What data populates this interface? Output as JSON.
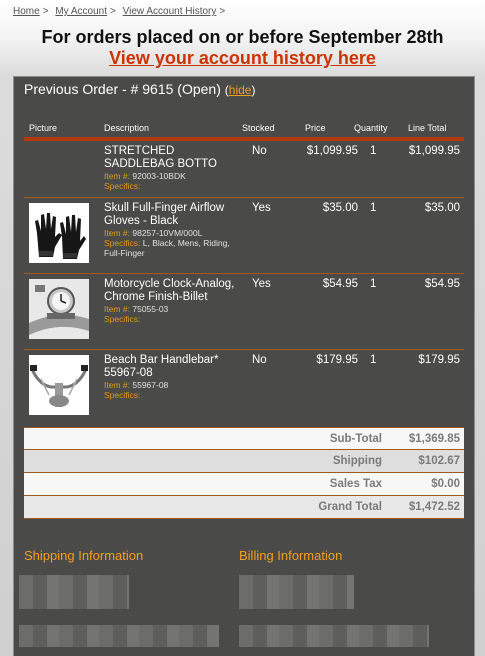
{
  "breadcrumb": {
    "items": [
      "Home",
      "My Account",
      "View Account History"
    ],
    "separator": ">"
  },
  "headline": "For orders placed on or before September 28th",
  "history_link": "View your account history here",
  "order": {
    "title": "Previous Order - # 9615 (Open)",
    "hide_open": "(",
    "hide_label": "hide",
    "hide_close": ")"
  },
  "table": {
    "headers": {
      "picture": "Picture",
      "description": "Description",
      "stocked": "Stocked",
      "price": "Price",
      "quantity": "Quantity",
      "line_total": "Line Total"
    },
    "item_label": "Item #:",
    "specifics_label": "Specifics:",
    "rows": [
      {
        "name": "STRETCHED SADDLEBAG BOTTO",
        "item_no": "92003-10BDK",
        "specifics": "",
        "stocked": "No",
        "price": "$1,099.95",
        "qty": "1",
        "total": "$1,099.95"
      },
      {
        "name": "Skull Full-Finger Airflow Gloves - Black",
        "item_no": "98257-10VM/000L",
        "specifics": "L, Black, Mens, Riding, Full-Finger",
        "stocked": "Yes",
        "price": "$35.00",
        "qty": "1",
        "total": "$35.00"
      },
      {
        "name": "Motorcycle Clock-Analog, Chrome Finish-Billet",
        "item_no": "75055-03",
        "specifics": "",
        "stocked": "Yes",
        "price": "$54.95",
        "qty": "1",
        "total": "$54.95"
      },
      {
        "name": "Beach Bar Handlebar* 55967-08",
        "item_no": "55967-08",
        "specifics": "",
        "stocked": "No",
        "price": "$179.95",
        "qty": "1",
        "total": "$179.95"
      }
    ]
  },
  "totals": {
    "subtotal_label": "Sub-Total",
    "subtotal": "$1,369.85",
    "shipping_label": "Shipping",
    "shipping": "$102.67",
    "tax_label": "Sales Tax",
    "tax": "$0.00",
    "grand_label": "Grand Total",
    "grand": "$1,472.52"
  },
  "shipping_info_title": "Shipping Information",
  "billing_info_title": "Billing Information",
  "colors": {
    "accent_orange": "#f0a020",
    "link_red": "#cc3300",
    "panel_bg": "#4a4a48",
    "rule": "#b43a10"
  }
}
